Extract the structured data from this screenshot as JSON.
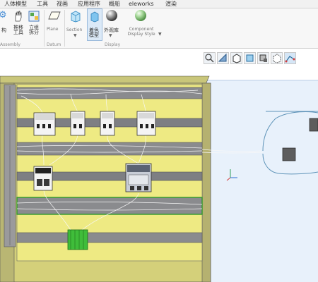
{
  "menu": [
    "人体模型",
    "工具",
    "视画",
    "应用程序",
    "概船",
    "eleworks",
    "渲染"
  ],
  "ribbon": {
    "buttons": {
      "struct": "构",
      "push": "推移\n工具",
      "split": "立组\n拆分",
      "plane": "Plane",
      "section": "Section",
      "render": "着色\n模型",
      "appearance": "外观库",
      "component_display": "Component\nDisplay Style"
    },
    "groups": {
      "assembly": "Assembly",
      "datum": "Datum",
      "display": "Display"
    }
  },
  "view_toolbar": [
    "zoom-fit-icon",
    "view-orient-icon",
    "box-view-icon",
    "section-view-icon",
    "refit-icon",
    "hidden-line-icon",
    "wire-icon"
  ],
  "colors": {
    "panel_yellow": "#eeea83",
    "rail": "#7e7f83",
    "grid_blue": "#e8f1fb",
    "accent_green": "#3fbd3a"
  }
}
